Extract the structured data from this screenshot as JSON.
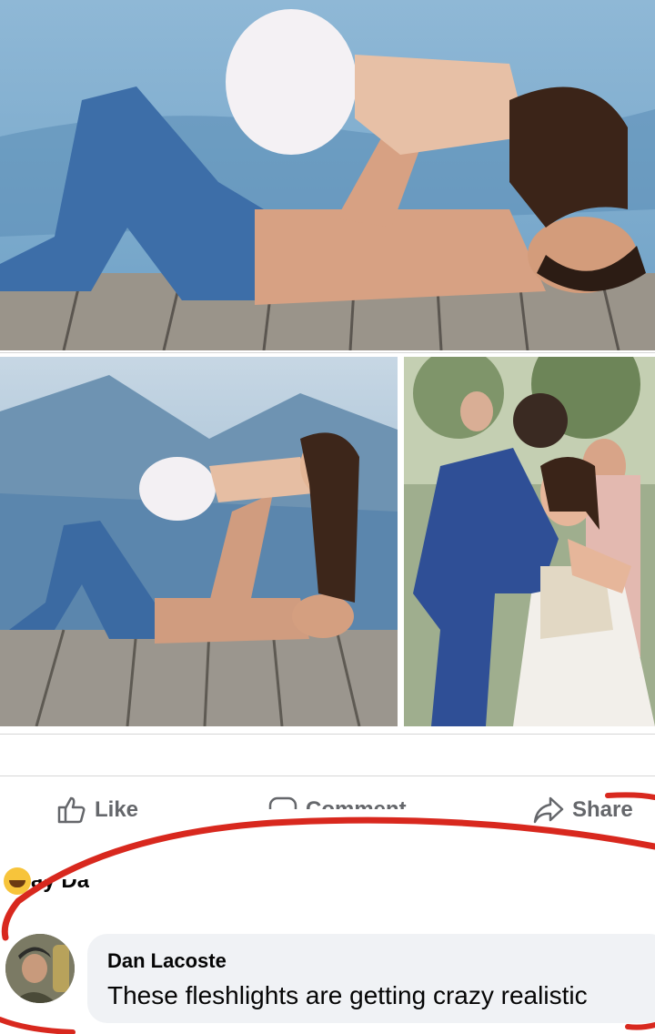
{
  "actions": {
    "like_label": "Like",
    "comment_label": "Comment",
    "share_label": "Share"
  },
  "reaction_row": {
    "name_fragment": "ay Da",
    "emoji_icon": "laughing-emoji-icon"
  },
  "comment": {
    "author": "Dan Lacoste",
    "text": "These fleshlights are getting crazy realistic"
  },
  "colors": {
    "action_gray": "#65676b",
    "bubble_bg": "#f0f2f5",
    "annotation_red": "#d8281e"
  }
}
